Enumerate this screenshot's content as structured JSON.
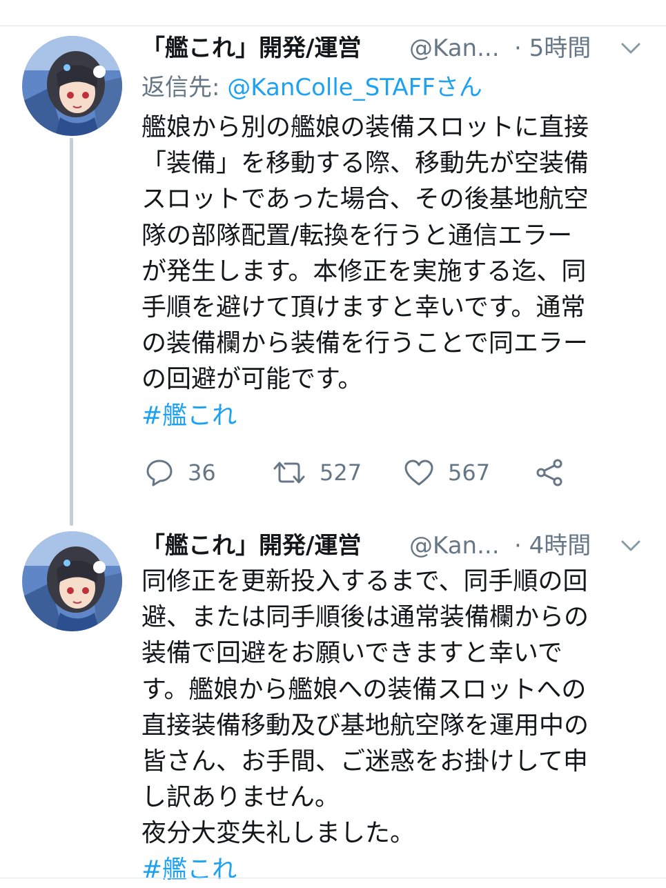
{
  "tweets": [
    {
      "author_name": "「艦これ」開発/運営",
      "handle": "@Kan...",
      "time": "· 5時間",
      "reply_label": "返信先:",
      "reply_mention": "@KanColle_STAFFさん",
      "lines": [
        "艦娘から別の艦娘の装備スロットに直接",
        "「装備」を移動する際、移動先が空装備",
        "スロットであった場合、その後基地航空",
        "隊の部隊配置/転換を行うと通信エラー",
        "が発生します。本修正を実施する迄、同",
        "手順を避けて頂けますと幸いです。通常",
        "の装備欄から装備を行うことで同エラー",
        "の回避が可能です。"
      ],
      "hashtag": "#艦これ",
      "replies": "36",
      "retweets": "527",
      "likes": "567"
    },
    {
      "author_name": "「艦これ」開発/運営",
      "handle": "@Kan...",
      "time": "· 4時間",
      "lines": [
        "同修正を更新投入するまで、同手順の回",
        "避、または同手順後は通常装備欄からの",
        "装備で回避をお願いできますと幸いで",
        "す。艦娘から艦娘への装備スロットへの",
        "直接装備移動及び基地航空隊を運用中の",
        "皆さん、お手間、ご迷惑をお掛けして申",
        "し訳ありません。",
        "夜分大変失礼しました。"
      ],
      "hashtag": "#艦これ"
    }
  ],
  "colors": {
    "text": "#14171a",
    "secondary": "#657786",
    "link": "#1da1f2",
    "thread_line": "#c4cfd6",
    "divider": "#e1e8ed"
  },
  "icons": {
    "reply": "speech-bubble-icon",
    "retweet": "retweet-arrows-icon",
    "like": "heart-icon",
    "share": "share-nodes-icon",
    "menu": "chevron-down-icon"
  }
}
